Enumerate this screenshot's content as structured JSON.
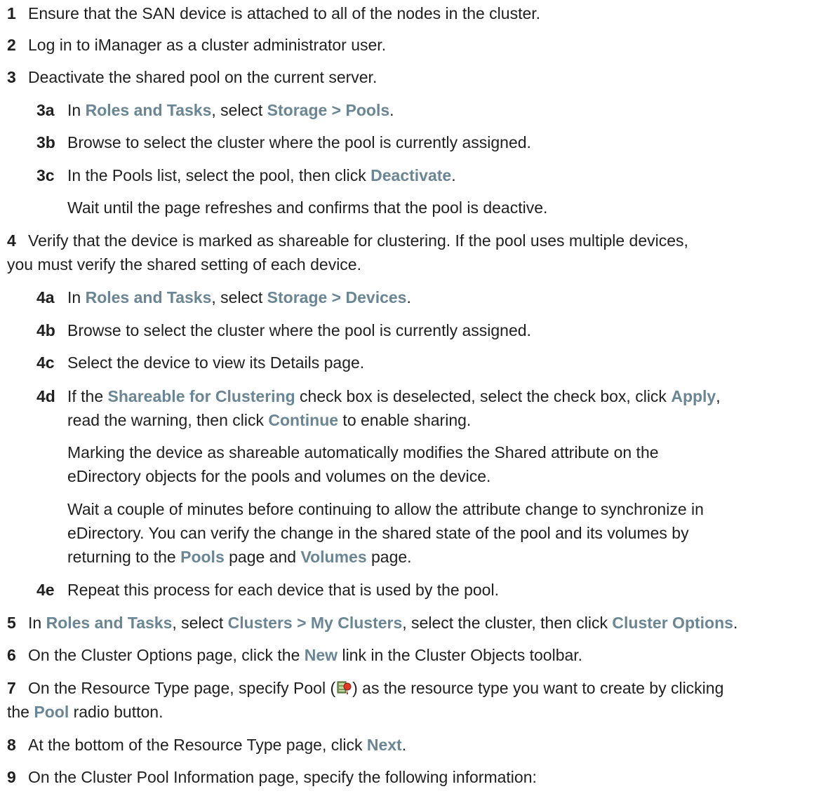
{
  "steps": [
    {
      "num": "1",
      "parts": [
        {
          "t": "Ensure that the SAN device is attached to all of the nodes in the cluster."
        }
      ]
    },
    {
      "num": "2",
      "parts": [
        {
          "t": "Log in to iManager as a cluster administrator user."
        }
      ]
    },
    {
      "num": "3",
      "parts": [
        {
          "t": "Deactivate the shared pool on the current server."
        }
      ]
    },
    {
      "num": "3a",
      "parts": [
        {
          "t": "In "
        },
        {
          "t": "Roles and Tasks",
          "ui": true
        },
        {
          "t": ", select "
        },
        {
          "t": "Storage > Pools",
          "ui": true
        },
        {
          "t": "."
        }
      ]
    },
    {
      "num": "3b",
      "parts": [
        {
          "t": "Browse to select the cluster where the pool is currently assigned."
        }
      ]
    },
    {
      "num": "3c",
      "parts": [
        {
          "t": "In the Pools list, select the pool, then click "
        },
        {
          "t": "Deactivate",
          "ui": true
        },
        {
          "t": "."
        }
      ]
    },
    {
      "num": "",
      "parts": [
        {
          "t": "Wait until the page refreshes and confirms that the pool is deactive."
        }
      ]
    },
    {
      "num": "4",
      "parts": [
        {
          "t": "Verify that the device is marked as shareable for clustering. If the pool uses multiple devices,"
        }
      ]
    },
    {
      "num": "",
      "parts": [
        {
          "t": "you must verify the shared setting of each device."
        }
      ]
    },
    {
      "num": "4a",
      "parts": [
        {
          "t": "In "
        },
        {
          "t": "Roles and Tasks",
          "ui": true
        },
        {
          "t": ", select "
        },
        {
          "t": "Storage > Devices",
          "ui": true
        },
        {
          "t": "."
        }
      ]
    },
    {
      "num": "4b",
      "parts": [
        {
          "t": "Browse to select the cluster where the pool is currently assigned."
        }
      ]
    },
    {
      "num": "4c",
      "parts": [
        {
          "t": "Select the device to view its Details page."
        }
      ]
    },
    {
      "num": "4d",
      "parts": [
        {
          "t": "If the "
        },
        {
          "t": "Shareable for Clustering",
          "ui": true
        },
        {
          "t": " check box is deselected, select the check box, click "
        },
        {
          "t": "Apply",
          "ui": true
        },
        {
          "t": ","
        }
      ]
    },
    {
      "num": "",
      "parts": [
        {
          "t": "read the warning, then click "
        },
        {
          "t": "Continue",
          "ui": true
        },
        {
          "t": " to enable sharing."
        }
      ]
    },
    {
      "num": "",
      "parts": [
        {
          "t": "Marking the device as shareable automatically modifies the Shared attribute on the"
        }
      ]
    },
    {
      "num": "",
      "parts": [
        {
          "t": "eDirectory objects for the pools and volumes on the device."
        }
      ]
    },
    {
      "num": "",
      "parts": [
        {
          "t": "Wait a couple of minutes before continuing to allow the attribute change to synchronize in"
        }
      ]
    },
    {
      "num": "",
      "parts": [
        {
          "t": "eDirectory. You can verify the change in the shared state of the pool and its volumes by"
        }
      ]
    },
    {
      "num": "",
      "parts": [
        {
          "t": "returning to the "
        },
        {
          "t": "Pools",
          "ui": true
        },
        {
          "t": " page and "
        },
        {
          "t": "Volumes",
          "ui": true
        },
        {
          "t": " page."
        }
      ]
    },
    {
      "num": "4e",
      "parts": [
        {
          "t": "Repeat this process for each device that is used by the pool."
        }
      ]
    },
    {
      "num": "5",
      "parts": [
        {
          "t": "In "
        },
        {
          "t": "Roles and Tasks",
          "ui": true
        },
        {
          "t": ", select "
        },
        {
          "t": "Clusters > My Clusters",
          "ui": true
        },
        {
          "t": ", select the cluster, then click "
        },
        {
          "t": "Cluster Options",
          "ui": true
        },
        {
          "t": "."
        }
      ]
    },
    {
      "num": "6",
      "parts": [
        {
          "t": "On the Cluster Options page, click the "
        },
        {
          "t": "New",
          "ui": true
        },
        {
          "t": " link in the Cluster Objects toolbar."
        }
      ]
    },
    {
      "num": "7",
      "parts": [
        {
          "t": "On the Resource Type page, specify Pool ("
        },
        {
          "icon": "pool-icon"
        },
        {
          "t": ") as the resource type you want to create by clicking"
        }
      ]
    },
    {
      "num": "",
      "parts": [
        {
          "t": "the "
        },
        {
          "t": "Pool",
          "ui": true
        },
        {
          "t": " radio button."
        }
      ]
    },
    {
      "num": "8",
      "parts": [
        {
          "t": "At the bottom of the Resource Type page, click "
        },
        {
          "t": "Next",
          "ui": true
        },
        {
          "t": "."
        }
      ]
    },
    {
      "num": "9",
      "parts": [
        {
          "t": "On the Cluster Pool Information page, specify the following information:"
        }
      ]
    }
  ]
}
